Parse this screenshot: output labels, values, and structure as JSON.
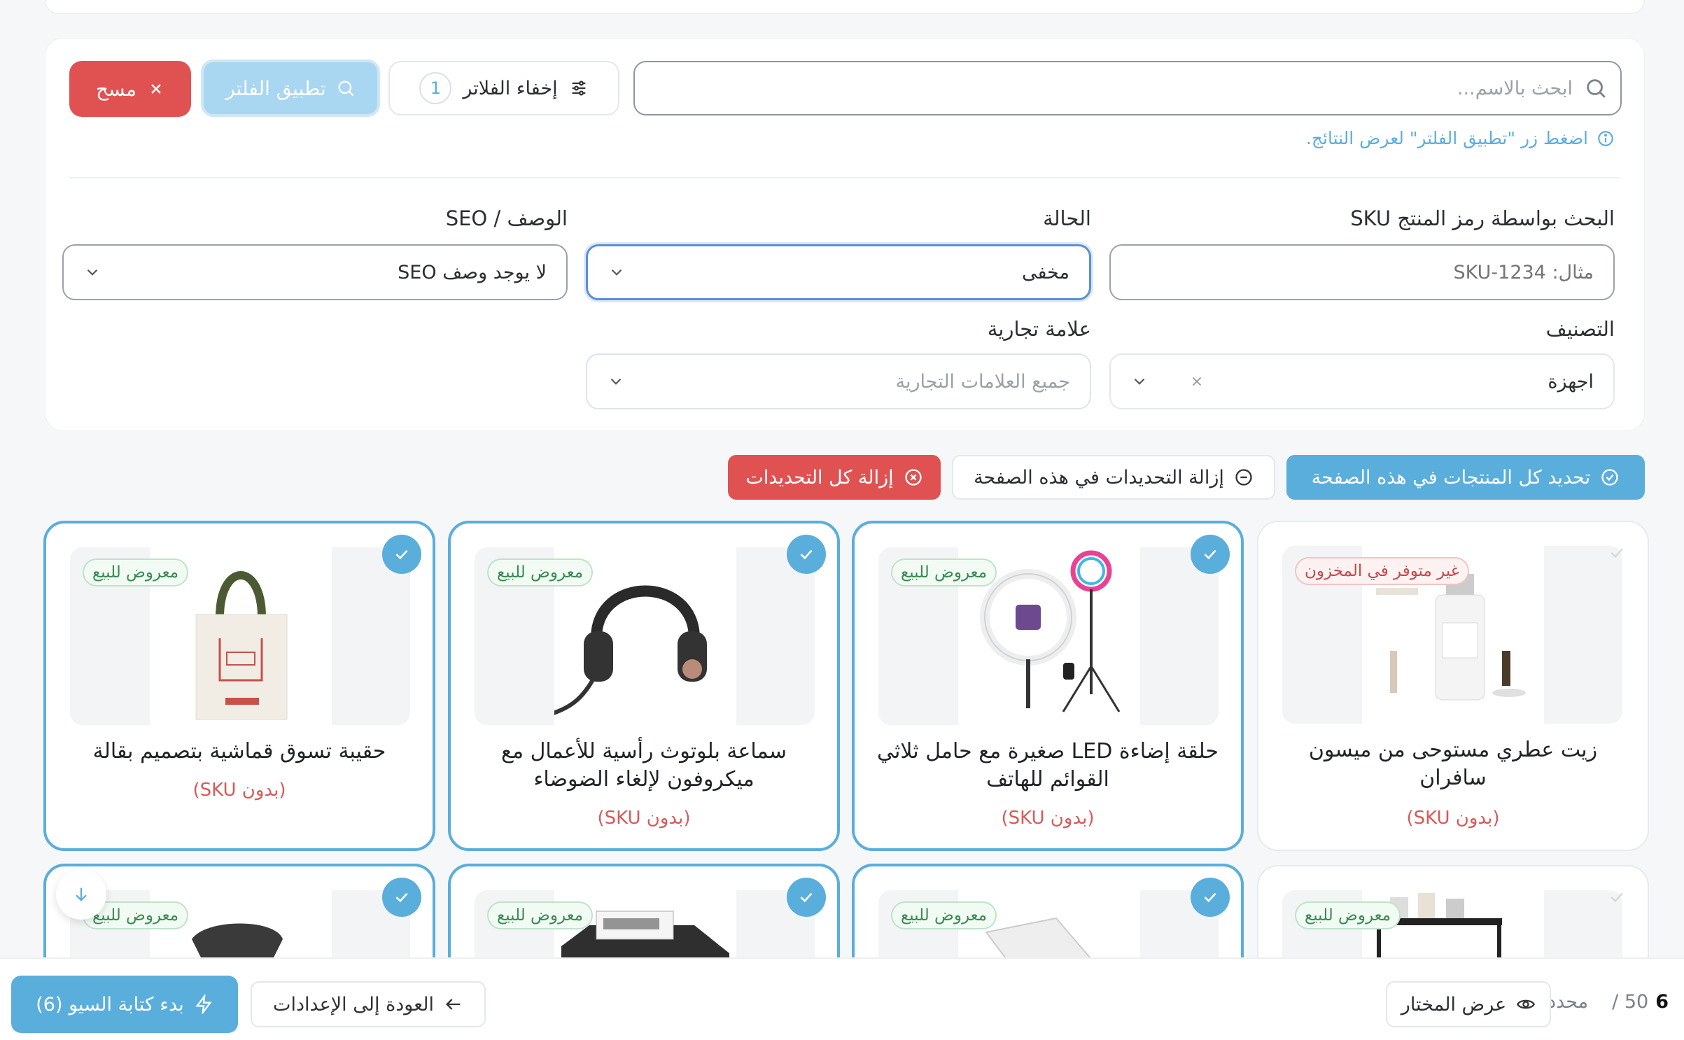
{
  "search": {
    "placeholder": "ابحث بالاسم..."
  },
  "toolbar": {
    "hide_filters_label": "إخفاء الفلاتر",
    "filter_count": "1",
    "apply_label": "تطبيق الفلتر",
    "clear_label": "مسح"
  },
  "hint": "اضغط زر \"تطبيق الفلتر\" لعرض النتائج.",
  "filters": {
    "sku": {
      "label": "البحث بواسطة رمز المنتج SKU",
      "placeholder": "مثال: SKU-1234"
    },
    "status": {
      "label": "الحالة",
      "value": "مخفى"
    },
    "seo": {
      "label": "الوصف / SEO",
      "value": "لا يوجد وصف SEO"
    },
    "category": {
      "label": "التصنيف",
      "value": "اجهزة"
    },
    "brand": {
      "label": "علامة تجارية",
      "placeholder": "جميع العلامات التجارية"
    }
  },
  "selection": {
    "select_page": "تحديد كل المنتجات في هذه الصفحة",
    "deselect_page": "إزالة التحديدات في هذه الصفحة",
    "deselect_all": "إزالة كل التحديدات"
  },
  "products": [
    {
      "title": "زيت عطري مستوحى من ميسون سافران",
      "sku": "(بدون SKU)",
      "badge": "غير متوفر في المخزون",
      "selected": false
    },
    {
      "title": "حلقة إضاءة LED صغيرة مع حامل ثلاثي القوائم للهاتف",
      "sku": "(بدون SKU)",
      "badge": "معروض للبيع",
      "selected": true
    },
    {
      "title": "سماعة بلوتوث رأسية للأعمال مع ميكروفون لإلغاء الضوضاء",
      "sku": "(بدون SKU)",
      "badge": "معروض للبيع",
      "selected": true
    },
    {
      "title": "حقيبة تسوق قماشية بتصميم بقالة",
      "sku": "(بدون SKU)",
      "badge": "معروض للبيع",
      "selected": true
    },
    {
      "badge": "معروض للبيع",
      "selected": false
    },
    {
      "badge": "معروض للبيع",
      "selected": true
    },
    {
      "badge": "معروض للبيع",
      "selected": true
    },
    {
      "badge": "معروض للبيع",
      "selected": true
    }
  ],
  "bottom": {
    "selected_count": "6",
    "total": "50 /",
    "selected_word": "محدد",
    "view_selected": "عرض المختار",
    "back_settings": "العودة إلى الإعدادات",
    "start_seo": "بدء كتابة السيو (6)"
  },
  "colors": {
    "accent": "#5aaedc",
    "danger": "#e05252"
  }
}
